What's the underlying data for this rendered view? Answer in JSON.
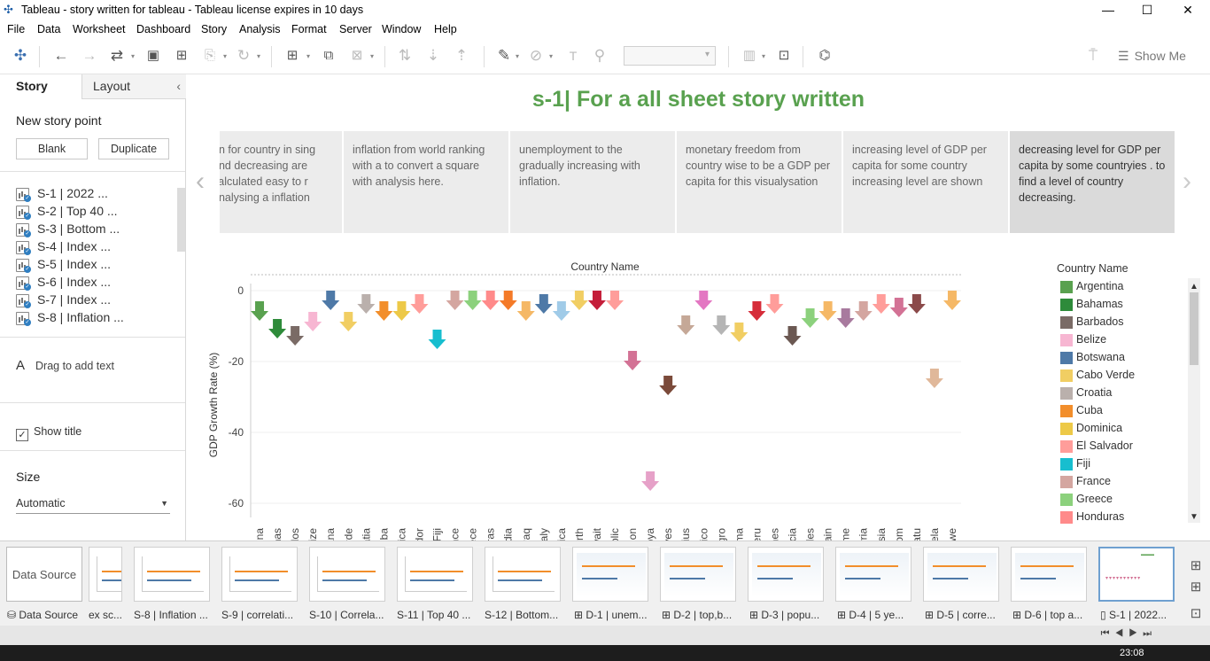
{
  "window": {
    "title": "Tableau - story written for tableau - Tableau license expires in 10 days",
    "min": "—",
    "max": "☐",
    "close": "✕"
  },
  "menu": [
    "File",
    "Data",
    "Worksheet",
    "Dashboard",
    "Story",
    "Analysis",
    "Format",
    "Server",
    "Window",
    "Help"
  ],
  "toolbar": {
    "show_me": "Show Me"
  },
  "sidebar": {
    "tab_story": "Story",
    "tab_layout": "Layout",
    "collapse": "‹",
    "new_point": "New story point",
    "blank": "Blank",
    "duplicate": "Duplicate",
    "points": [
      "S-1 | 2022 ...",
      "S-2 | Top 40 ...",
      "S-3 | Bottom ...",
      "S-4 | Index ...",
      "S-5 | Index ...",
      "S-6 | Index ...",
      "S-7 | Index ...",
      "S-8 | Inflation ..."
    ],
    "drag_text": "Drag to add text",
    "drag_icon": "A",
    "show_title": "Show title",
    "show_title_checked": true,
    "size_label": "Size",
    "size_value": "Automatic"
  },
  "story": {
    "title": "s-1| For a all sheet story written",
    "captions": [
      "on for  country in sing and decreasing are calculated easy to r analysing a inflation",
      "inflation from world ranking with a to convert a square with analysis here.",
      "unemployment to the gradually increasing with inflation.",
      "monetary freedom from country wise to be a GDP per capita for this visualysation",
      "increasing level of GDP per capita for some country increasing level are shown",
      "decreasing level for GDP per capita by some countryies . to find a level of country decreasing."
    ]
  },
  "colors": {
    "title_green": "#59a14f"
  },
  "chart_data": {
    "type": "scatter",
    "mark": "arrow-down",
    "title": "Country Name",
    "ylabel": "GDP Growth Rate (%)",
    "ylim": [
      -64,
      2
    ],
    "yticks": [
      0,
      -20,
      -40,
      -60
    ],
    "categories": [
      "Argentina",
      "Bahamas",
      "Barbados",
      "Belize",
      "Botswana",
      "Cabo Verde",
      "Croatia",
      "Cuba",
      "Dominica",
      "El Salvador",
      "Fiji",
      "France",
      "Greece",
      "Honduras",
      "India",
      "Iraq",
      "Italy",
      "Jamaica",
      "Korea North",
      "Kuwait",
      "Kyrgyz Republic",
      "Lebanon",
      "Libya",
      "Maldives",
      "Mauritius",
      "Mexico",
      "Montenegro",
      "Panama",
      "Peru",
      "Philippines",
      "Saint Lucia",
      "Seychelles",
      "Spain",
      "Suriname",
      "Syria",
      "Tunisia",
      "United Kingdom",
      "Vanuatu",
      "Venezuela",
      "Zimbabwe"
    ],
    "values": [
      -7,
      -12,
      -14,
      -10,
      -4,
      -10,
      -5,
      -7,
      -7,
      -5,
      -15,
      -4,
      -4,
      -4,
      -4,
      -7,
      -5,
      -7,
      -4,
      -4,
      -4,
      -21,
      -55,
      -28,
      -11,
      -4,
      -11,
      -13,
      -7,
      -5,
      -14,
      -9,
      -7,
      -9,
      -7,
      -5,
      -6,
      -5,
      -26,
      -4
    ],
    "colors": [
      "#59a14f",
      "#2e8b3a",
      "#7a6b66",
      "#f7b6d2",
      "#4e79a7",
      "#f1ce63",
      "#bab0ac",
      "#f28e2b",
      "#edc948",
      "#ff9d9a",
      "#17becf",
      "#d4a6a0",
      "#8cd17d",
      "#ff8a8a",
      "#f47a28",
      "#f5b866",
      "#4e79a7",
      "#a0cbe8",
      "#f1ce63",
      "#c41e3a",
      "#ff9d9a",
      "#d37295",
      "#e6a1c8",
      "#7b4a3a",
      "#c5a897",
      "#e377c2",
      "#b5b5b5",
      "#f1ce63",
      "#d62d3a",
      "#ff9d9a",
      "#6b5852",
      "#8cd17d",
      "#f5b866",
      "#a87a9e",
      "#d4a6a0",
      "#ff9d9a",
      "#d37295",
      "#8b4a4a",
      "#e0b89a",
      "#f5b866"
    ]
  },
  "legend": {
    "title": "Country Name",
    "items": [
      {
        "name": "Argentina",
        "color": "#59a14f"
      },
      {
        "name": "Bahamas",
        "color": "#2e8b3a"
      },
      {
        "name": "Barbados",
        "color": "#7a6b66"
      },
      {
        "name": "Belize",
        "color": "#f7b6d2"
      },
      {
        "name": "Botswana",
        "color": "#4e79a7"
      },
      {
        "name": "Cabo Verde",
        "color": "#f1ce63"
      },
      {
        "name": "Croatia",
        "color": "#bab0ac"
      },
      {
        "name": "Cuba",
        "color": "#f28e2b"
      },
      {
        "name": "Dominica",
        "color": "#edc948"
      },
      {
        "name": "El Salvador",
        "color": "#ff9d9a"
      },
      {
        "name": "Fiji",
        "color": "#17becf"
      },
      {
        "name": "France",
        "color": "#d4a6a0"
      },
      {
        "name": "Greece",
        "color": "#8cd17d"
      },
      {
        "name": "Honduras",
        "color": "#ff8a8a"
      }
    ]
  },
  "tabs": [
    {
      "label": "Data Source",
      "thumb": "Data Source",
      "type": "ds"
    },
    {
      "label": "ex sc...",
      "type": "sheet"
    },
    {
      "label": "S-8 | Inflation ...",
      "type": "sheet"
    },
    {
      "label": "S-9 | correlati...",
      "type": "sheet"
    },
    {
      "label": "S-10 | Correla...",
      "type": "sheet"
    },
    {
      "label": "S-11 | Top 40 ...",
      "type": "sheet"
    },
    {
      "label": "S-12 | Bottom...",
      "type": "sheet"
    },
    {
      "label": "D-1 | unem...",
      "type": "dash"
    },
    {
      "label": "D-2 | top,b...",
      "type": "dash"
    },
    {
      "label": "D-3 | popu...",
      "type": "dash"
    },
    {
      "label": "D-4 |  5 ye...",
      "type": "dash"
    },
    {
      "label": "D-5 | corre...",
      "type": "dash"
    },
    {
      "label": "D-6 | top a...",
      "type": "dash"
    },
    {
      "label": "S-1 | 2022...",
      "type": "story",
      "selected": true
    }
  ],
  "taskbar": {
    "clock": "23:08"
  }
}
